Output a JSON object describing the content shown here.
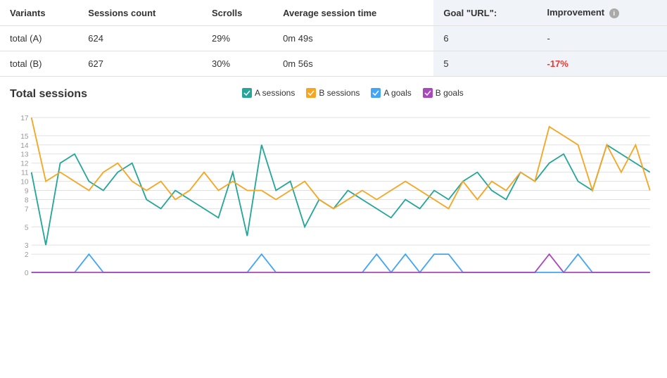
{
  "table": {
    "headers": {
      "variants": "Variants",
      "sessions_count": "Sessions count",
      "scrolls": "Scrolls",
      "avg_session_time": "Average session time",
      "goal_url": "Goal \"URL\":",
      "improvement": "Improvement"
    },
    "rows": [
      {
        "variant": "total (A)",
        "sessions_count": "624",
        "scrolls": "29%",
        "avg_session_time": "0m 49s",
        "goal_url": "6",
        "improvement": "-",
        "improvement_class": "neutral"
      },
      {
        "variant": "total (B)",
        "sessions_count": "627",
        "scrolls": "30%",
        "avg_session_time": "0m 56s",
        "goal_url": "5",
        "improvement": "-17%",
        "improvement_class": "negative"
      }
    ]
  },
  "chart": {
    "title": "Total sessions",
    "legend": [
      {
        "label": "A sessions",
        "color": "#26a69a",
        "shape": "check"
      },
      {
        "label": "B sessions",
        "color": "#f5a623",
        "shape": "check"
      },
      {
        "label": "A goals",
        "color": "#42a5f5",
        "shape": "check"
      },
      {
        "label": "B goals",
        "color": "#ab47bc",
        "shape": "check"
      }
    ],
    "y_labels": [
      "0",
      "2",
      "3",
      "5",
      "7",
      "8",
      "9",
      "10",
      "11",
      "12",
      "13",
      "14",
      "15",
      "17"
    ],
    "y_ticks": [
      0,
      2,
      3,
      5,
      7,
      8,
      9,
      10,
      11,
      12,
      13,
      14,
      15,
      17
    ]
  }
}
